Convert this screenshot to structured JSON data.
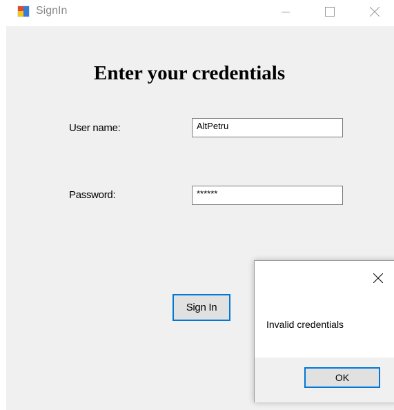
{
  "window": {
    "title": "SignIn",
    "app_icon": "winforms-app-icon",
    "controls": {
      "minimize": "minimize-icon",
      "maximize": "maximize-icon",
      "close": "close-icon"
    }
  },
  "form": {
    "heading": "Enter your credentials",
    "username_label": "User name:",
    "username_value": "AltPetru",
    "password_label": "Password:",
    "password_value": "******",
    "signin_label": "Sign In"
  },
  "message_box": {
    "message": "Invalid credentials",
    "ok_label": "OK",
    "close_icon": "close-icon"
  },
  "colors": {
    "accent": "#0078d7",
    "client_background": "#f0f0f0",
    "button_face": "#e1e1e1"
  }
}
